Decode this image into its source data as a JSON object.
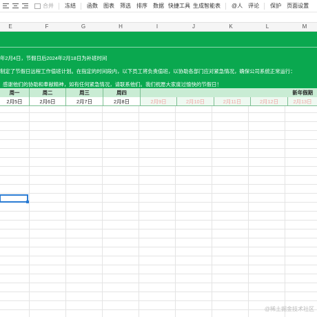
{
  "toolbar": {
    "merge": "合并",
    "freeze": "冻结",
    "function": "函数",
    "chart": "图表",
    "filter": "筛选",
    "sort": "排序",
    "data": "数据",
    "quick_tools": "快捷工具",
    "smart_table": "生成智能表",
    "mention": "@人",
    "comment": "评论",
    "protect": "保护",
    "page_setup": "页面设置"
  },
  "columns": [
    "E",
    "F",
    "G",
    "H",
    "I",
    "J",
    "K",
    "L",
    "M"
  ],
  "banner": {
    "line1": "年2月4日，节假日后2024年2月18日为补班时间",
    "line2": "制定了节假日远程工作值班计划。在指定的时间段内，以下员工将负责值班，以协助各部门应对紧急情况，确保公司系统正常运行：",
    "line3": "感谢他们的协助和奉献精神，如有任何紧急情况，请联系他们。我们祝愿大家度过愉快的节假日！"
  },
  "days": [
    "周一",
    "周二",
    "周三",
    "周四"
  ],
  "holiday_label": "新年假期",
  "dates": [
    "2月5日",
    "2月6日",
    "2月7日",
    "2月8日"
  ],
  "holiday_dates": [
    "2月9日",
    "2月10日",
    "2月11日",
    "2月12日",
    "2月13日"
  ],
  "watermark": "@稀土掘金技术社区",
  "colors": {
    "banner": "#0aa84f",
    "header_fill": "#c9ecd4",
    "holiday_text": "#f2a3a3",
    "selection": "#2b7cd3"
  }
}
